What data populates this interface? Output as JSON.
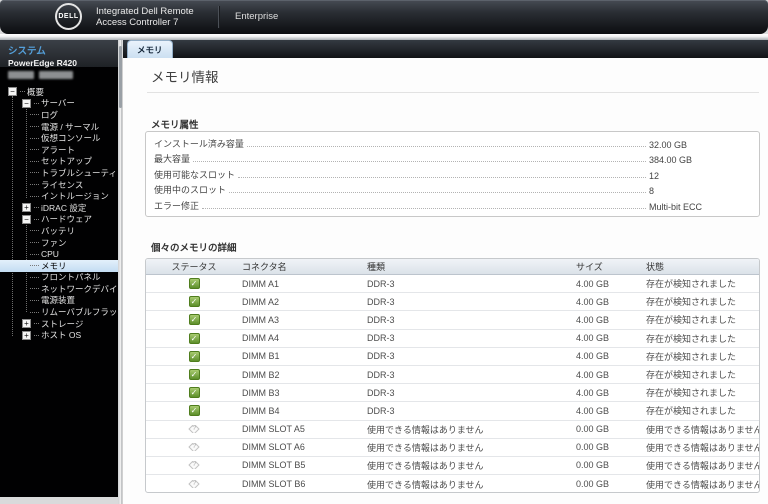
{
  "header": {
    "logo": "DELL",
    "title_line1": "Integrated Dell Remote",
    "title_line2": "Access Controller 7",
    "edition": "Enterprise"
  },
  "sidebar": {
    "system_label": "システム",
    "system_name": "PowerEdge R420",
    "tree": [
      {
        "label": "概要",
        "level": 0,
        "expander": "minus"
      },
      {
        "label": "サーバー",
        "level": 1,
        "expander": "minus"
      },
      {
        "label": "ログ",
        "level": 2
      },
      {
        "label": "電源 / サーマル",
        "level": 2
      },
      {
        "label": "仮想コンソール",
        "level": 2
      },
      {
        "label": "アラート",
        "level": 2
      },
      {
        "label": "セットアップ",
        "level": 2
      },
      {
        "label": "トラブルシューティング",
        "level": 2
      },
      {
        "label": "ライセンス",
        "level": 2
      },
      {
        "label": "イントルージョン",
        "level": 2
      },
      {
        "label": "iDRAC 設定",
        "level": 1,
        "expander": "plus"
      },
      {
        "label": "ハードウェア",
        "level": 1,
        "expander": "minus"
      },
      {
        "label": "バッテリ",
        "level": 2
      },
      {
        "label": "ファン",
        "level": 2
      },
      {
        "label": "CPU",
        "level": 2
      },
      {
        "label": "メモリ",
        "level": 2,
        "selected": true
      },
      {
        "label": "フロントパネル",
        "level": 2
      },
      {
        "label": "ネットワークデバイス",
        "level": 2
      },
      {
        "label": "電源装置",
        "level": 2
      },
      {
        "label": "リムーバブルフラッシュ",
        "level": 2
      },
      {
        "label": "ストレージ",
        "level": 1,
        "expander": "plus"
      },
      {
        "label": "ホスト OS",
        "level": 1,
        "expander": "plus"
      }
    ]
  },
  "tab": {
    "label": "メモリ"
  },
  "main": {
    "page_title": "メモリ情報",
    "attributes_section": {
      "title": "メモリ属性",
      "rows": [
        {
          "label": "インストール済み容量",
          "value": "32.00 GB"
        },
        {
          "label": "最大容量",
          "value": "384.00 GB"
        },
        {
          "label": "使用可能なスロット",
          "value": "12"
        },
        {
          "label": "使用中のスロット",
          "value": "8"
        },
        {
          "label": "エラー修正",
          "value": "Multi-bit ECC"
        }
      ]
    },
    "details_section": {
      "title": "個々のメモリの詳細",
      "columns": [
        "ステータス",
        "コネクタ名",
        "種類",
        "サイズ",
        "状態"
      ],
      "rows": [
        {
          "status_icon": "ok",
          "connector": "DIMM A1",
          "type": "DDR-3",
          "size": "4.00 GB",
          "state": "存在が検知されました"
        },
        {
          "status_icon": "ok",
          "connector": "DIMM A2",
          "type": "DDR-3",
          "size": "4.00 GB",
          "state": "存在が検知されました"
        },
        {
          "status_icon": "ok",
          "connector": "DIMM A3",
          "type": "DDR-3",
          "size": "4.00 GB",
          "state": "存在が検知されました"
        },
        {
          "status_icon": "ok",
          "connector": "DIMM A4",
          "type": "DDR-3",
          "size": "4.00 GB",
          "state": "存在が検知されました"
        },
        {
          "status_icon": "ok",
          "connector": "DIMM B1",
          "type": "DDR-3",
          "size": "4.00 GB",
          "state": "存在が検知されました"
        },
        {
          "status_icon": "ok",
          "connector": "DIMM B2",
          "type": "DDR-3",
          "size": "4.00 GB",
          "state": "存在が検知されました"
        },
        {
          "status_icon": "ok",
          "connector": "DIMM B3",
          "type": "DDR-3",
          "size": "4.00 GB",
          "state": "存在が検知されました"
        },
        {
          "status_icon": "ok",
          "connector": "DIMM B4",
          "type": "DDR-3",
          "size": "4.00 GB",
          "state": "存在が検知されました"
        },
        {
          "status_icon": "unknown",
          "connector": "DIMM SLOT A5",
          "type": "使用できる情報はありません",
          "size": "0.00 GB",
          "state": "使用できる情報はありません"
        },
        {
          "status_icon": "unknown",
          "connector": "DIMM SLOT A6",
          "type": "使用できる情報はありません",
          "size": "0.00 GB",
          "state": "使用できる情報はありません"
        },
        {
          "status_icon": "unknown",
          "connector": "DIMM SLOT B5",
          "type": "使用できる情報はありません",
          "size": "0.00 GB",
          "state": "使用できる情報はありません"
        },
        {
          "status_icon": "unknown",
          "connector": "DIMM SLOT B6",
          "type": "使用できる情報はありません",
          "size": "0.00 GB",
          "state": "使用できる情報はありません"
        }
      ]
    }
  },
  "colors": {
    "accent_blue": "#55a1dc",
    "selected_item_bg": "#c3dcf2",
    "status_ok_green": "#5d8f2b",
    "status_unknown_gray": "#c2c2c2",
    "header_dark": "#15171b"
  }
}
